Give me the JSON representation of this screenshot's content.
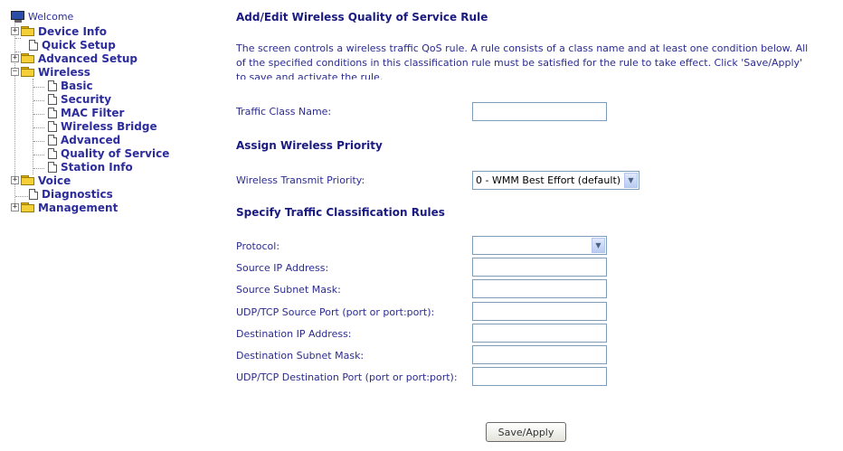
{
  "sidebar": {
    "welcome": "Welcome",
    "items": [
      {
        "label": "Device Info"
      },
      {
        "label": "Quick Setup"
      },
      {
        "label": "Advanced Setup"
      },
      {
        "label": "Wireless"
      },
      {
        "label": "Basic"
      },
      {
        "label": "Security"
      },
      {
        "label": "MAC Filter"
      },
      {
        "label": "Wireless Bridge"
      },
      {
        "label": "Advanced"
      },
      {
        "label": "Quality of Service"
      },
      {
        "label": "Station Info"
      },
      {
        "label": "Voice"
      },
      {
        "label": "Diagnostics"
      },
      {
        "label": "Management"
      }
    ]
  },
  "main": {
    "title": "Add/Edit Wireless Quality of Service Rule",
    "description": "The screen controls  a wireless traffic QoS rule. A rule consists of a class name and at least one condition below. All of the specified conditions in this classification rule must be satisfied for the rule to take effect. Click 'Save/Apply' to save and activate the rule.",
    "traffic_class_label": "Traffic Class Name:",
    "traffic_class_value": "",
    "priority_section": "Assign Wireless Priority",
    "priority_label": "Wireless Transmit Priority:",
    "priority_value": "0 - WMM Best Effort (default)",
    "rules_section": "Specify Traffic Classification Rules",
    "protocol_label": "Protocol:",
    "protocol_value": "",
    "fields": [
      {
        "label": "Source IP Address:",
        "value": ""
      },
      {
        "label": "Source Subnet Mask:",
        "value": ""
      },
      {
        "label": "UDP/TCP Source Port (port or port:port):",
        "value": ""
      },
      {
        "label": "Destination IP Address:",
        "value": ""
      },
      {
        "label": "Destination Subnet Mask:",
        "value": ""
      },
      {
        "label": "UDP/TCP Destination Port (port or port:port):",
        "value": ""
      }
    ],
    "save_label": "Save/Apply"
  }
}
